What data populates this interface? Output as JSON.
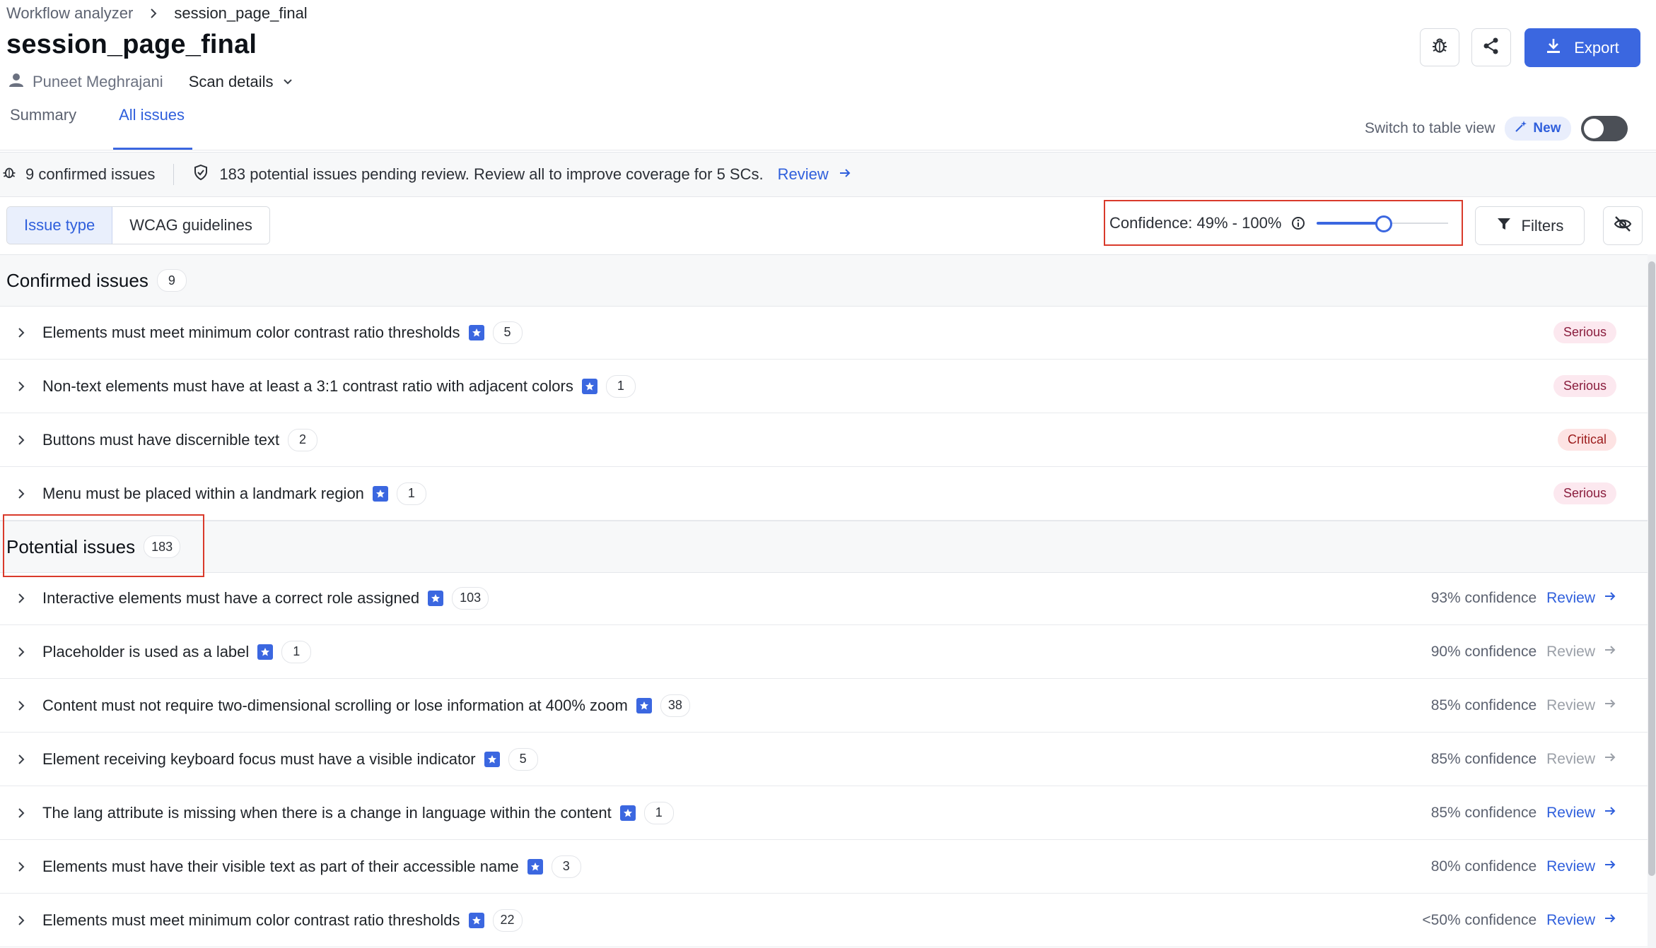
{
  "breadcrumb": {
    "parent": "Workflow analyzer",
    "current": "session_page_final"
  },
  "page_title": "session_page_final",
  "meta": {
    "user": "Puneet Meghrajani",
    "scan_details": "Scan details"
  },
  "header_actions": {
    "export_label": "Export"
  },
  "tabs": [
    {
      "label": "Summary",
      "active": false
    },
    {
      "label": "All issues",
      "active": true
    }
  ],
  "table_view": {
    "label": "Switch to table view",
    "badge": "New",
    "enabled": false
  },
  "status": {
    "confirmed": "9 confirmed issues",
    "potential": "183 potential issues pending review. Review all to improve coverage for 5 SCs.",
    "review_link": "Review"
  },
  "segments": [
    {
      "label": "Issue type",
      "active": true
    },
    {
      "label": "WCAG guidelines",
      "active": false
    }
  ],
  "confidence": {
    "label": "Confidence: 49% - 100%",
    "min": 49,
    "max": 100
  },
  "filters_label": "Filters",
  "confirmed_section": {
    "title": "Confirmed issues",
    "count": "9",
    "items": [
      {
        "text": "Elements must meet minimum color contrast ratio thresholds",
        "star": true,
        "count": "5",
        "severity": "Serious",
        "level": "serious"
      },
      {
        "text": "Non-text elements must have at least a 3:1 contrast ratio with adjacent colors",
        "star": true,
        "count": "1",
        "severity": "Serious",
        "level": "serious"
      },
      {
        "text": "Buttons must have discernible text",
        "star": false,
        "count": "2",
        "severity": "Critical",
        "level": "critical"
      },
      {
        "text": "Menu must be placed within a landmark region",
        "star": true,
        "count": "1",
        "severity": "Serious",
        "level": "serious"
      }
    ]
  },
  "potential_section": {
    "title": "Potential issues",
    "count": "183",
    "items": [
      {
        "text": "Interactive elements must have a correct role assigned",
        "star": true,
        "count": "103",
        "confidence": "93% confidence",
        "review": "Review",
        "review_active": true
      },
      {
        "text": "Placeholder is used as a label",
        "star": true,
        "count": "1",
        "confidence": "90% confidence",
        "review": "Review",
        "review_active": false
      },
      {
        "text": "Content must not require two-dimensional scrolling or lose information at 400% zoom",
        "star": true,
        "count": "38",
        "confidence": "85% confidence",
        "review": "Review",
        "review_active": false
      },
      {
        "text": "Element receiving keyboard focus must have a visible indicator",
        "star": true,
        "count": "5",
        "confidence": "85% confidence",
        "review": "Review",
        "review_active": false
      },
      {
        "text": "The lang attribute is missing when there is a change in language within the content",
        "star": true,
        "count": "1",
        "confidence": "85% confidence",
        "review": "Review",
        "review_active": true
      },
      {
        "text": "Elements must have their visible text as part of their accessible name",
        "star": true,
        "count": "3",
        "confidence": "80% confidence",
        "review": "Review",
        "review_active": true
      },
      {
        "text": "Elements must meet minimum color contrast ratio thresholds",
        "star": true,
        "count": "22",
        "confidence": "<50% confidence",
        "review": "Review",
        "review_active": true
      }
    ]
  },
  "colors": {
    "accent": "#3b67e0",
    "highlight": "#d93a2b",
    "serious_bg": "#fce8ef",
    "critical_bg": "#fde3e3"
  }
}
